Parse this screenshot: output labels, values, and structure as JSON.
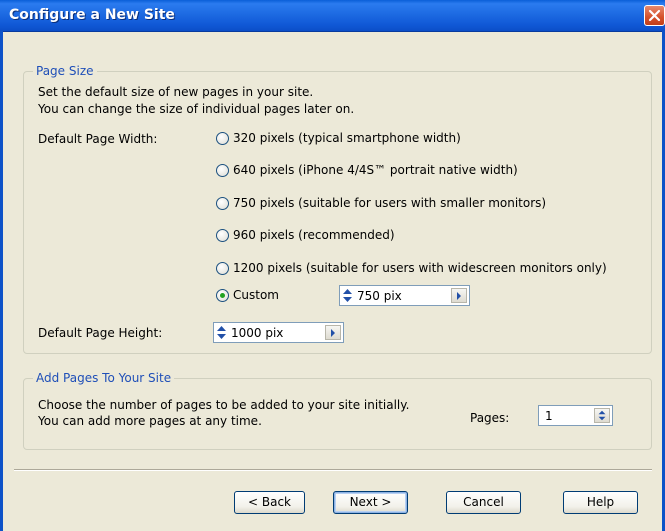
{
  "window": {
    "title": "Configure a New Site"
  },
  "page_size": {
    "legend": "Page Size",
    "desc_line1": "Set the default size of new pages in your site.",
    "desc_line2": "You can change the size of individual pages later on.",
    "width_label": "Default Page Width:",
    "options": [
      {
        "label": "320 pixels (typical smartphone width)",
        "selected": false
      },
      {
        "label": "640 pixels (iPhone 4/4S™ portrait native width)",
        "selected": false
      },
      {
        "label": "750 pixels (suitable for users with smaller monitors)",
        "selected": false
      },
      {
        "label": "960 pixels (recommended)",
        "selected": false
      },
      {
        "label": "1200 pixels (suitable for users with widescreen monitors only)",
        "selected": false
      },
      {
        "label": "Custom",
        "selected": true
      }
    ],
    "custom_value": "750 pix",
    "height_label": "Default Page Height:",
    "height_value": "1000 pix"
  },
  "add_pages": {
    "legend": "Add Pages To Your Site",
    "desc_line1": "Choose the number of pages to be added to your site initially.",
    "desc_line2": "You can add more pages at any time.",
    "pages_label": "Pages:",
    "pages_value": "1"
  },
  "buttons": {
    "back": "< Back",
    "next": "Next >",
    "cancel": "Cancel",
    "help": "Help"
  },
  "colors": {
    "title_bar": "#1f6de4",
    "group_legend": "#1f4fb8",
    "selected_radio": "#21a121",
    "dialog_bg": "#ece9d8"
  }
}
